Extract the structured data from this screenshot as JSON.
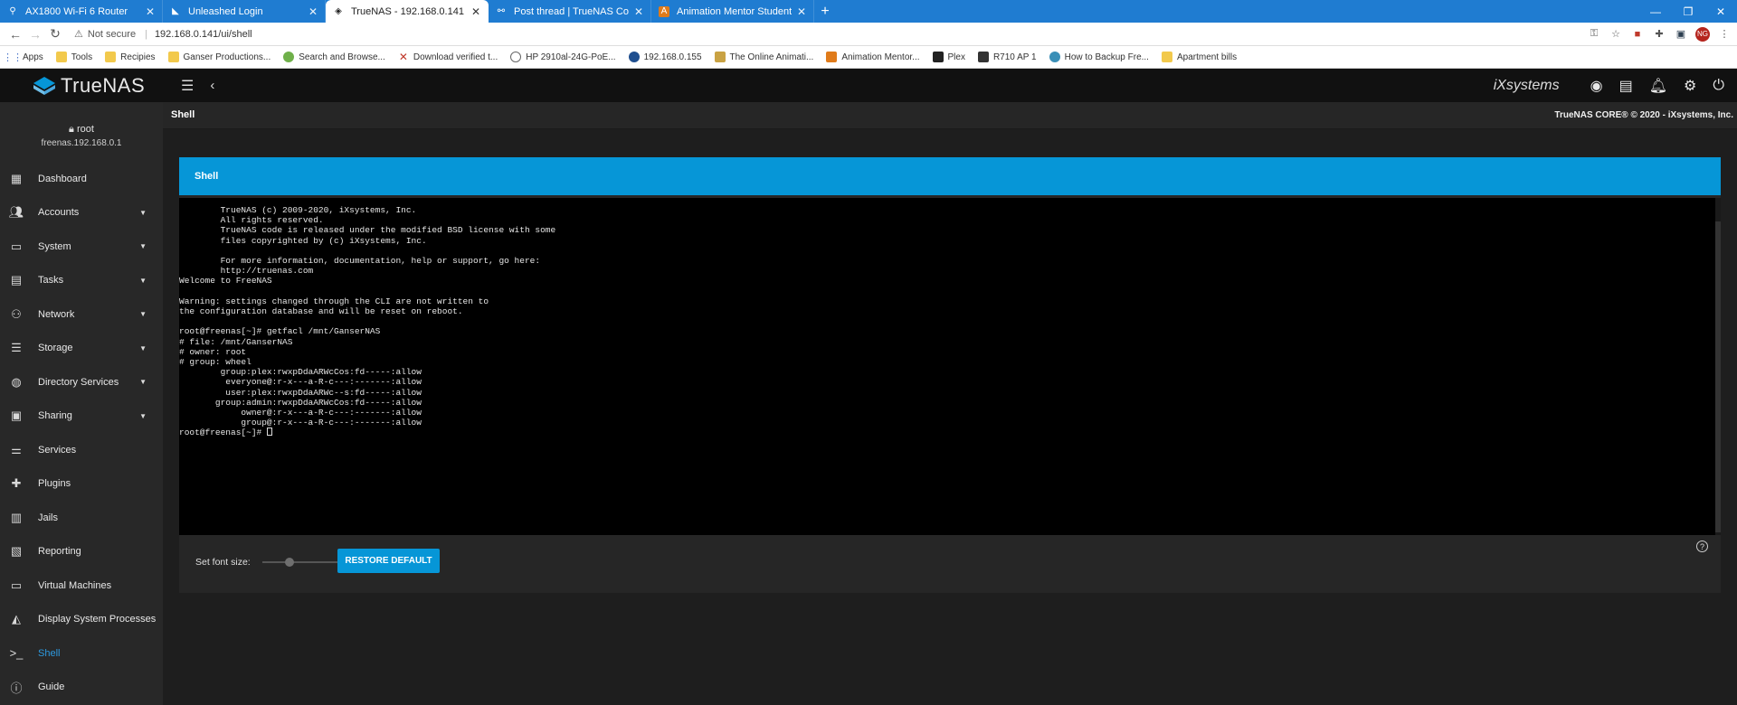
{
  "browser": {
    "tabs": [
      {
        "title": "AX1800 Wi-Fi 6 Router",
        "icon": "router-icon",
        "active": false
      },
      {
        "title": "Unleashed Login",
        "icon": "ruckus-icon",
        "active": false
      },
      {
        "title": "TrueNAS - 192.168.0.141",
        "icon": "truenas-icon",
        "active": true
      },
      {
        "title": "Post thread | TrueNAS Communi",
        "icon": "forum-icon",
        "active": false
      },
      {
        "title": "Animation Mentor Student Camp",
        "icon": "am-icon",
        "active": false
      }
    ],
    "new_tab": "+",
    "security": "Not secure",
    "url": "192.168.0.141/ui/shell",
    "profile_initials": "NG",
    "bookmarks": [
      "Apps",
      "Tools",
      "Recipies",
      "Ganser Productions...",
      "Search and Browse...",
      "Download verified t...",
      "HP 2910al-24G-PoE...",
      "192.168.0.155",
      "The Online Animati...",
      "Animation Mentor...",
      "Plex",
      "R710 AP 1",
      "How to Backup Fre...",
      "Apartment bills"
    ]
  },
  "app": {
    "logo_text": "TrueNAS",
    "vendor": "iXsystems",
    "page_title": "Shell",
    "copyright": "TrueNAS CORE® © 2020 - iXsystems, Inc.",
    "user": "root",
    "hostname": "freenas.192.168.0.1",
    "accent": "#0696d7"
  },
  "nav": [
    {
      "label": "Dashboard",
      "icon": "dashboard-icon",
      "expandable": false
    },
    {
      "label": "Accounts",
      "icon": "accounts-icon",
      "expandable": true
    },
    {
      "label": "System",
      "icon": "system-icon",
      "expandable": true
    },
    {
      "label": "Tasks",
      "icon": "tasks-icon",
      "expandable": true
    },
    {
      "label": "Network",
      "icon": "network-icon",
      "expandable": true
    },
    {
      "label": "Storage",
      "icon": "storage-icon",
      "expandable": true
    },
    {
      "label": "Directory Services",
      "icon": "directory-services-icon",
      "expandable": true
    },
    {
      "label": "Sharing",
      "icon": "sharing-icon",
      "expandable": true
    },
    {
      "label": "Services",
      "icon": "services-icon",
      "expandable": false
    },
    {
      "label": "Plugins",
      "icon": "plugins-icon",
      "expandable": false
    },
    {
      "label": "Jails",
      "icon": "jails-icon",
      "expandable": false
    },
    {
      "label": "Reporting",
      "icon": "reporting-icon",
      "expandable": false
    },
    {
      "label": "Virtual Machines",
      "icon": "virtual-machines-icon",
      "expandable": false
    },
    {
      "label": "Display System Processes",
      "icon": "processes-icon",
      "expandable": false
    },
    {
      "label": "Shell",
      "icon": "shell-icon",
      "expandable": false,
      "active": true
    },
    {
      "label": "Guide",
      "icon": "guide-icon",
      "expandable": false
    }
  ],
  "shell": {
    "card_title": "Shell",
    "terminal_lines": [
      "        TrueNAS (c) 2009-2020, iXsystems, Inc.",
      "        All rights reserved.",
      "        TrueNAS code is released under the modified BSD license with some",
      "        files copyrighted by (c) iXsystems, Inc.",
      "",
      "        For more information, documentation, help or support, go here:",
      "        http://truenas.com",
      "Welcome to FreeNAS",
      "",
      "Warning: settings changed through the CLI are not written to",
      "the configuration database and will be reset on reboot.",
      "",
      "root@freenas[~]# getfacl /mnt/GanserNAS",
      "# file: /mnt/GanserNAS",
      "# owner: root",
      "# group: wheel",
      "        group:plex:rwxpDdaARWcCos:fd-----:allow",
      "         everyone@:r-x---a-R-c---:-------:allow",
      "         user:plex:rwxpDdaARWc--s:fd-----:allow",
      "       group:admin:rwxpDdaARWcCos:fd-----:allow",
      "            owner@:r-x---a-R-c---:-------:allow",
      "            group@:r-x---a-R-c---:-------:allow"
    ],
    "prompt": "root@freenas[~]# ",
    "font_size_label": "Set font size:",
    "font_size_level": 0.33,
    "restore_label": "RESTORE DEFAULT"
  }
}
